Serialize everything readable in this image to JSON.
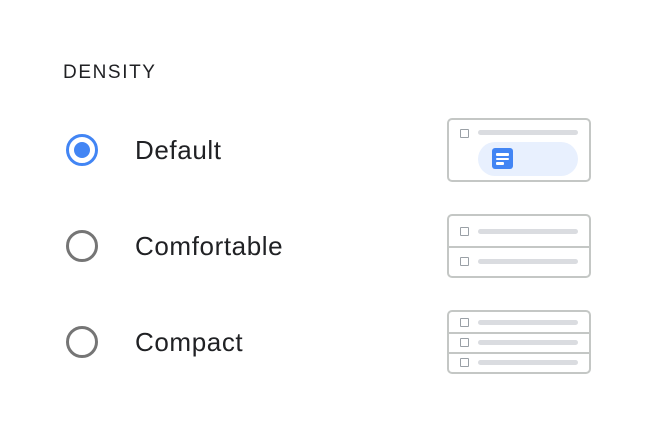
{
  "section": {
    "title": "DENSITY"
  },
  "options": [
    {
      "label": "Default",
      "selected": true
    },
    {
      "label": "Comfortable",
      "selected": false
    },
    {
      "label": "Compact",
      "selected": false
    }
  ],
  "colors": {
    "accent": "#4285f4",
    "radio_unselected": "#757575",
    "text": "#202124",
    "preview_border": "#c4c7c5",
    "preview_line": "#dadce0",
    "preview_highlight": "#e8f0fe"
  },
  "icons": {
    "preview_document": "document-icon"
  }
}
